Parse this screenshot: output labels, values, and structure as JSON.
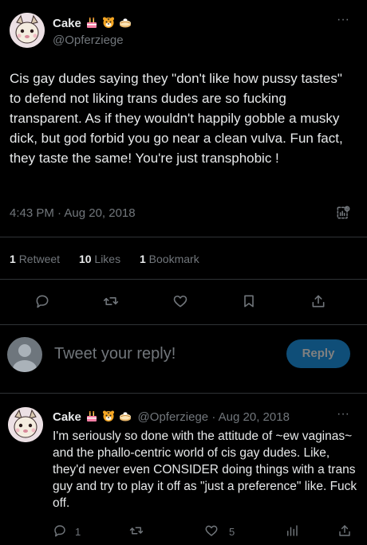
{
  "tweet": {
    "name": "Cake",
    "handle": "@Opferziege",
    "more_label": "···",
    "text": "Cis gay dudes saying they \"don't like how pussy tastes\" to defend not liking trans dudes are so fucking transparent. As if they wouldn't happily gobble a musky dick, but god forbid you go near a clean vulva. Fun fact, they taste the same! You're just transphobic !",
    "timestamp": "4:43 PM · Aug 20, 2018",
    "stats": {
      "retweets_count": "1",
      "retweets_label": "Retweet",
      "likes_count": "10",
      "likes_label": "Likes",
      "bookmarks_count": "1",
      "bookmarks_label": "Bookmark"
    }
  },
  "composer": {
    "placeholder": "Tweet your reply!",
    "reply_button": "Reply"
  },
  "reply": {
    "name": "Cake",
    "handle": "@Opferziege",
    "separator": "·",
    "date": "Aug 20, 2018",
    "more_label": "···",
    "text": "I'm seriously so done with the attitude of ~ew vaginas~ and the phallo-centric world of cis gay dudes. Like, they'd never even CONSIDER doing things with a trans guy and try to play it off as \"just a preference\" like. Fuck off.",
    "reply_count": "1",
    "like_count": "5"
  },
  "colors": {
    "background": "#000000",
    "text": "#e7e9ea",
    "muted": "#71767b",
    "divider": "#2f3336",
    "reply_button_bg": "#1d9bf0"
  },
  "icons": [
    "birthday-cake-icon",
    "tiger-face-icon",
    "pie-icon",
    "views-icon",
    "reply-icon",
    "retweet-icon",
    "like-icon",
    "bookmark-icon",
    "share-icon",
    "analytics-icon"
  ]
}
